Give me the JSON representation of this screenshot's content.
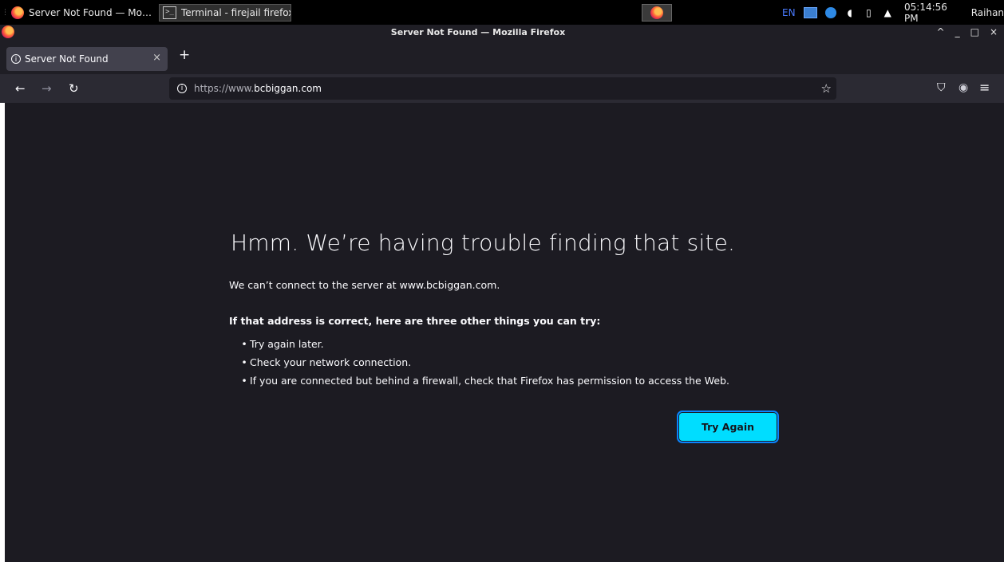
{
  "taskbar": {
    "tasks": [
      {
        "label": "Server Not Found — Mo…",
        "icon": "firefox-icon"
      },
      {
        "label": "Terminal - firejail firefox",
        "icon": "terminal-icon"
      }
    ],
    "lang": "EN",
    "clock": "05:14:56 PM",
    "user": "Raihan"
  },
  "window": {
    "title": "Server Not Found — Mozilla Firefox",
    "controls": [
      "^",
      "_",
      "□",
      "×"
    ]
  },
  "tab": {
    "label": "Server Not Found",
    "close": "×",
    "new_tab": "+"
  },
  "nav": {
    "back": "←",
    "forward": "→",
    "reload": "↻",
    "url_prefix": "https://www.",
    "url_host": "bcbiggan.com",
    "bookmark": "☆",
    "pocket": "⛉",
    "extension": "◉",
    "menu": "≡"
  },
  "error": {
    "title": "Hmm. We’re having trouble finding that site.",
    "description": "We can’t connect to the server at www.bcbiggan.com.",
    "subtitle": "If that address is correct, here are three other things you can try:",
    "items": [
      "Try again later.",
      "Check your network connection.",
      "If you are connected but behind a firewall, check that Firefox has permission to access the Web."
    ],
    "button": "Try Again"
  }
}
